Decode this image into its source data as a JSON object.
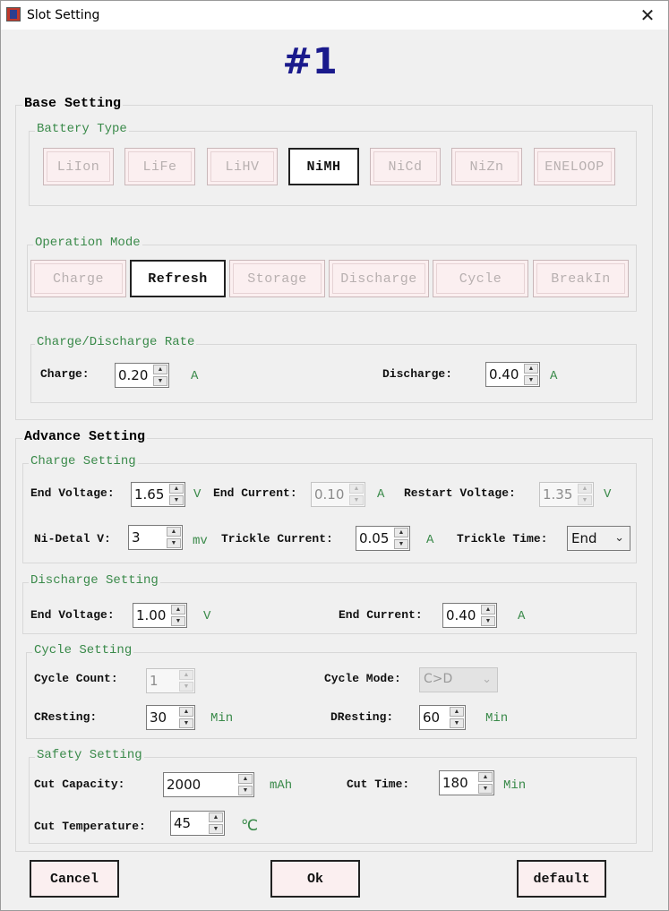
{
  "window": {
    "title": "Slot Setting",
    "close_glyph": "✕",
    "slot_number": "#1"
  },
  "base": {
    "title": "Base Setting",
    "battery_type": {
      "legend": "Battery Type",
      "options": [
        "LiIon",
        "LiFe",
        "LiHV",
        "NiMH",
        "NiCd",
        "NiZn",
        "ENELOOP"
      ],
      "selected": "NiMH"
    },
    "operation_mode": {
      "legend": "Operation Mode",
      "options": [
        "Charge",
        "Refresh",
        "Storage",
        "Discharge",
        "Cycle",
        "BreakIn"
      ],
      "selected": "Refresh"
    },
    "rate": {
      "legend": "Charge/Discharge Rate",
      "charge_label": "Charge:",
      "charge_value": "0.20",
      "charge_unit": "A",
      "discharge_label": "Discharge:",
      "discharge_value": "0.40",
      "discharge_unit": "A"
    }
  },
  "advance": {
    "title": "Advance Setting",
    "charge": {
      "legend": "Charge Setting",
      "end_voltage_label": "End Voltage:",
      "end_voltage_value": "1.65",
      "end_voltage_unit": "V",
      "end_current_label": "End Current:",
      "end_current_value": "0.10",
      "end_current_unit": "A",
      "restart_voltage_label": "Restart Voltage:",
      "restart_voltage_value": "1.35",
      "restart_voltage_unit": "V",
      "delta_v_label": "Ni-Detal V:",
      "delta_v_value": "3",
      "delta_v_unit": "mv",
      "trickle_current_label": "Trickle Current:",
      "trickle_current_value": "0.05",
      "trickle_current_unit": "A",
      "trickle_time_label": "Trickle Time:",
      "trickle_time_value": "End"
    },
    "discharge": {
      "legend": "Discharge Setting",
      "end_voltage_label": "End Voltage:",
      "end_voltage_value": "1.00",
      "end_voltage_unit": "V",
      "end_current_label": "End Current:",
      "end_current_value": "0.40",
      "end_current_unit": "A"
    },
    "cycle": {
      "legend": "Cycle Setting",
      "count_label": "Cycle Count:",
      "count_value": "1",
      "mode_label": "Cycle Mode:",
      "mode_value": "C>D",
      "cresting_label": "CResting:",
      "cresting_value": "30",
      "cresting_unit": "Min",
      "dresting_label": "DResting:",
      "dresting_value": "60",
      "dresting_unit": "Min"
    },
    "safety": {
      "legend": "Safety Setting",
      "cut_capacity_label": "Cut Capacity:",
      "cut_capacity_value": "2000",
      "cut_capacity_unit": "mAh",
      "cut_time_label": "Cut Time:",
      "cut_time_value": "180",
      "cut_time_unit": "Min",
      "cut_temp_label": "Cut Temperature:",
      "cut_temp_value": "45",
      "cut_temp_unit": "℃"
    }
  },
  "buttons": {
    "cancel": "Cancel",
    "ok": "Ok",
    "default": "default"
  },
  "icons": {
    "spin_up": "▲",
    "spin_down": "▼",
    "dropdown": "chevron-down-icon"
  },
  "colors": {
    "accent_title": "#1a1a8c",
    "legend_green": "#3a8a4a",
    "option_bg": "#fbeff0"
  }
}
